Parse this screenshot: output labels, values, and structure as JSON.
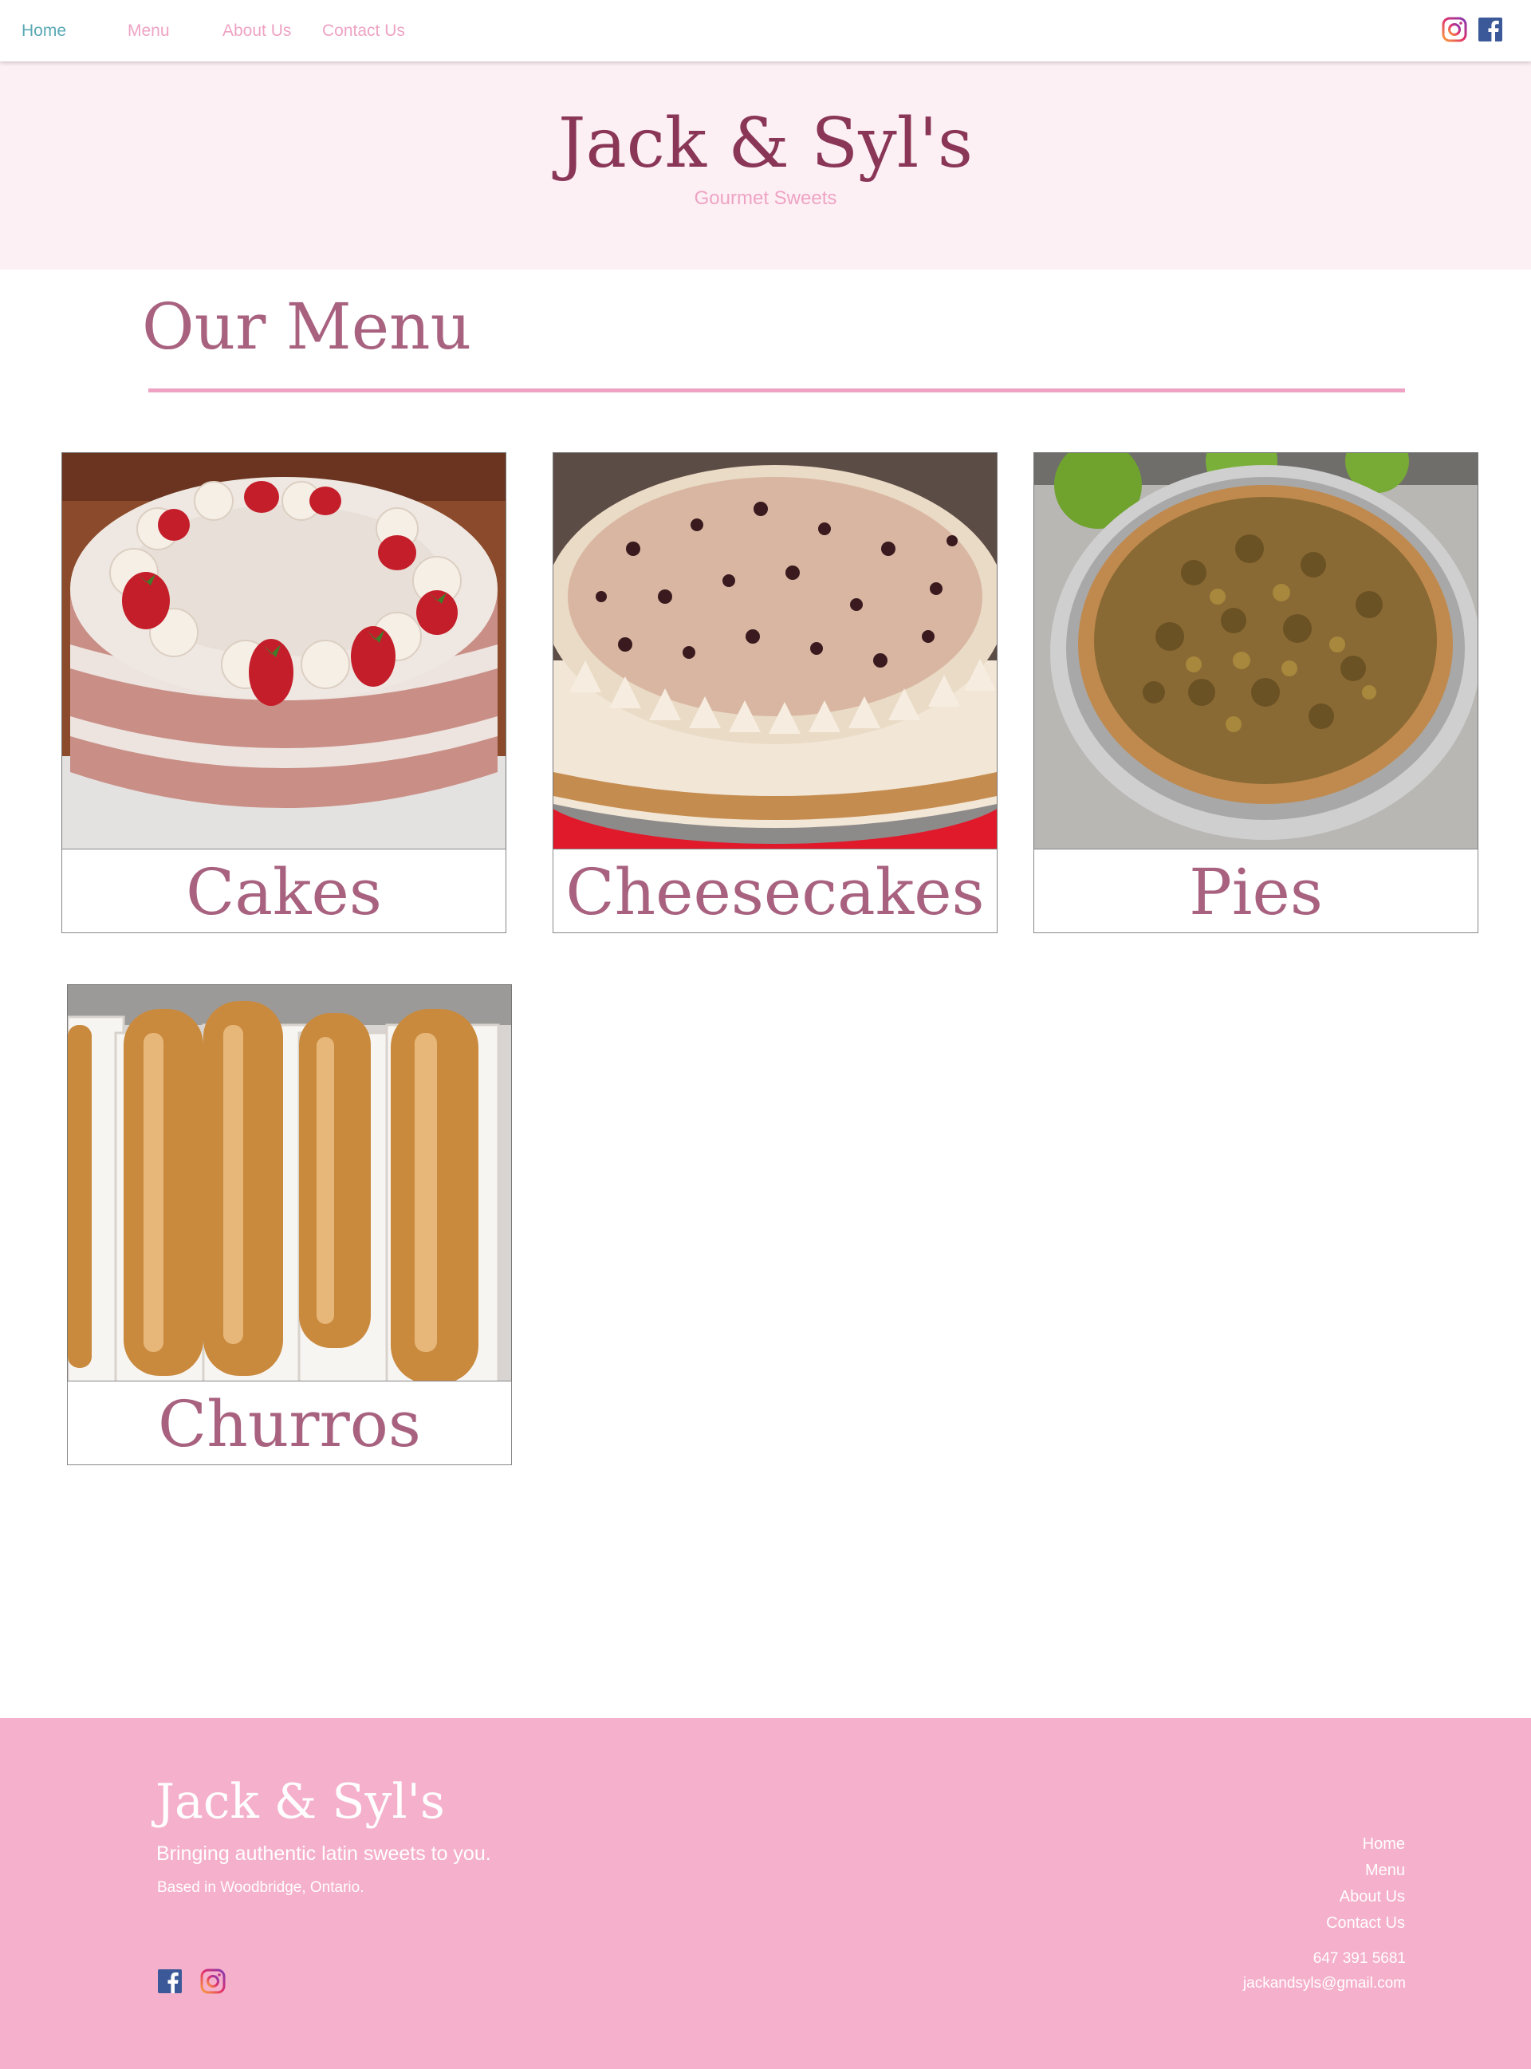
{
  "nav": {
    "items": [
      {
        "label": "Home",
        "active": true
      },
      {
        "label": "Menu",
        "active": false
      },
      {
        "label": "About Us",
        "active": false
      },
      {
        "label": "Contact Us",
        "active": false
      }
    ],
    "social_icons": [
      "instagram-icon",
      "facebook-icon"
    ]
  },
  "header": {
    "title": "Jack & Syl's",
    "tagline": "Gourmet Sweets"
  },
  "menu": {
    "heading": "Our Menu",
    "cards": [
      {
        "label": "Cakes",
        "image": "strawberry-cake-photo"
      },
      {
        "label": "Cheesecakes",
        "image": "chocolate-chip-cheesecake-photo"
      },
      {
        "label": "Pies",
        "image": "apple-crumble-pie-photo"
      },
      {
        "label": "Churros",
        "image": "churros-photo"
      }
    ]
  },
  "footer": {
    "title": "Jack & Syl's",
    "tagline": "Bringing authentic latin sweets to you.",
    "location": "Based in Woodbridge, Ontario.",
    "links": [
      "Home",
      "Menu",
      "About Us",
      "Contact Us"
    ],
    "phone": "647 391 5681",
    "email": "jackandsyls@gmail.com",
    "social_icons": [
      "facebook-icon",
      "instagram-icon"
    ]
  },
  "colors": {
    "accent_pink": "#eea3c4",
    "brand_plum": "#8a3657",
    "heading_mauve": "#a8627f",
    "active_teal": "#5aa9b5",
    "header_bg": "#fdf0f4",
    "footer_bg": "#f5b0cb"
  }
}
